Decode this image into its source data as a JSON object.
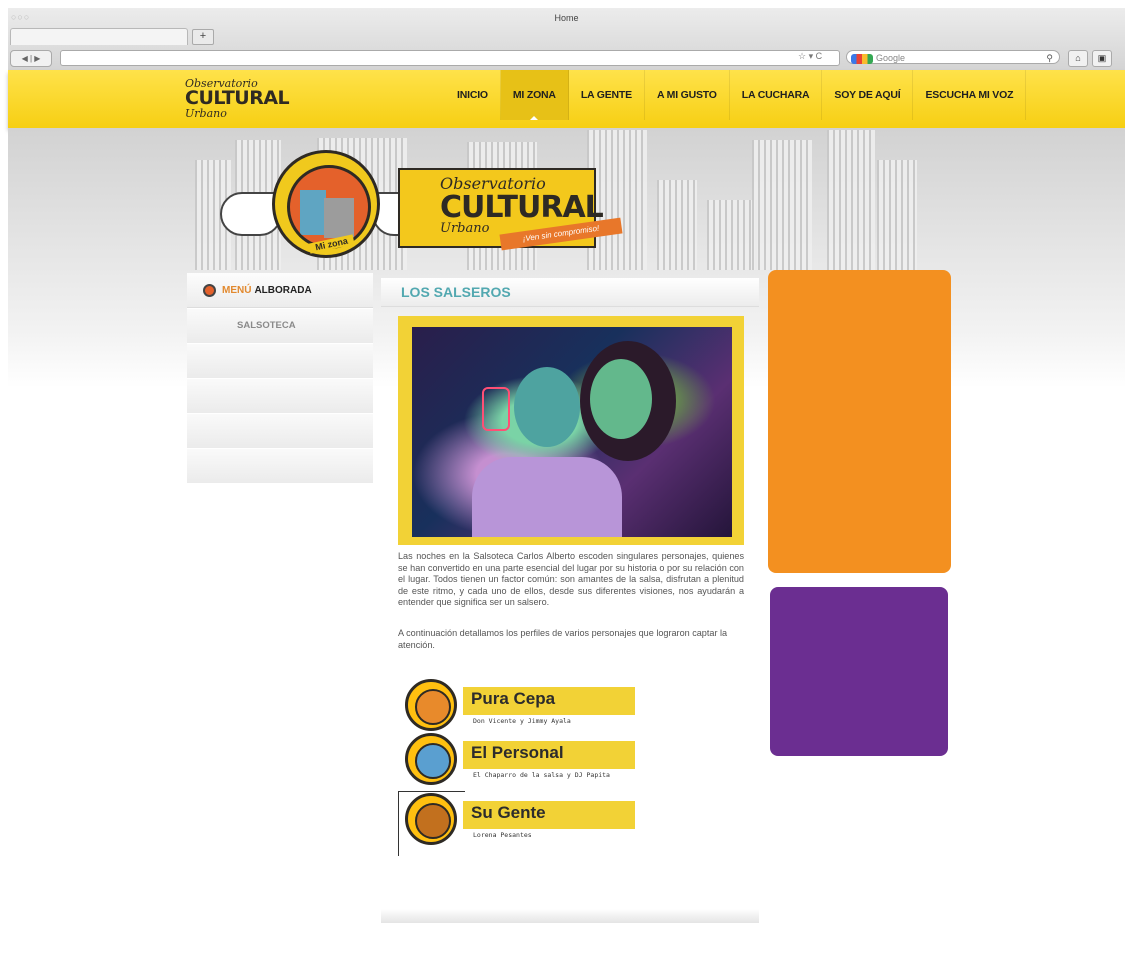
{
  "browser": {
    "window_title": "Home",
    "window_lights": "○○○",
    "new_tab": "+",
    "nav_buttons": "◀ | ▶",
    "url_icons": "☆ ▾ C",
    "search_placeholder": "Google",
    "search_icon": "magnifier-icon",
    "home_icon": "home-icon",
    "extra_icon": "bookmark-icon"
  },
  "site": {
    "logo_script_top": "Observatorio",
    "logo_big": "CULTURAL",
    "logo_script_bottom": "Urbano",
    "menu": [
      {
        "label": "INICIO"
      },
      {
        "label": "MI ZONA"
      },
      {
        "label": "LA GENTE"
      },
      {
        "label": "A MI GUSTO"
      },
      {
        "label": "LA CUCHARA"
      },
      {
        "label": "SOY DE AQUÍ"
      },
      {
        "label": "ESCUCHA MI VOZ"
      }
    ],
    "active_menu": "MI ZONA",
    "brand_colors": {
      "yellow": "#f6cf13",
      "orange": "#f39020",
      "purple": "#6b2e91",
      "teal": "#52a8b0"
    }
  },
  "hero": {
    "script_top": "Observatorio",
    "big": "CULTURAL",
    "script_bottom": "Urbano",
    "ribbon": "¡Ven sin compromiso!",
    "badge": "Mi zona"
  },
  "sidebar": {
    "menu_label": "MENÚ",
    "menu_name": "ALBORADA",
    "items": [
      {
        "label": "SALSOTECA"
      },
      {
        "label": ""
      },
      {
        "label": ""
      },
      {
        "label": ""
      },
      {
        "label": ""
      }
    ]
  },
  "main": {
    "title": "LOS SALSEROS",
    "paragraph1": "Las noches en la Salsoteca Carlos Alberto escoden singulares personajes, quienes se han convertido en una parte esencial del lugar por su historia o por su relación con el lugar. Todos tienen un factor común: son amantes de la salsa, disfrutan a plenitud de este ritmo, y cada uno de ellos, desde sus diferentes visiones, nos ayudarán a entender que significa ser un salsero.",
    "paragraph2": "A continuación detallamos los perfiles de varios personajes que lograron captar la atención.",
    "profiles": [
      {
        "title": "Pura Cepa",
        "subtitle": "Don Vicente y Jimmy Ayala",
        "icon": "person-icon"
      },
      {
        "title": "El Personal",
        "subtitle": "El Chaparro de la salsa y DJ Papita",
        "icon": "turntable-icon"
      },
      {
        "title": "Su Gente",
        "subtitle": "Lorena Pesantes",
        "icon": "dancer-legs-icon"
      }
    ]
  }
}
